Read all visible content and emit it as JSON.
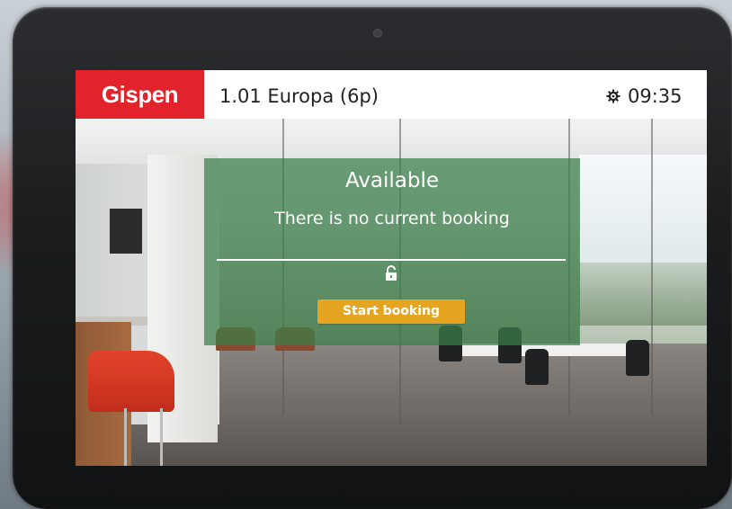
{
  "header": {
    "logo_text": "Gispen",
    "room_name": "1.01 Europa (6p)",
    "time": "09:35",
    "settings_icon": "gear-icon"
  },
  "panel": {
    "status": "Available",
    "message": "There is no current booking",
    "lock_icon": "unlocked-padlock-icon",
    "button_label": "Start booking"
  },
  "colors": {
    "brand_red": "#e2232b",
    "available_green": "#3a8048",
    "button_amber": "#e5a521"
  }
}
